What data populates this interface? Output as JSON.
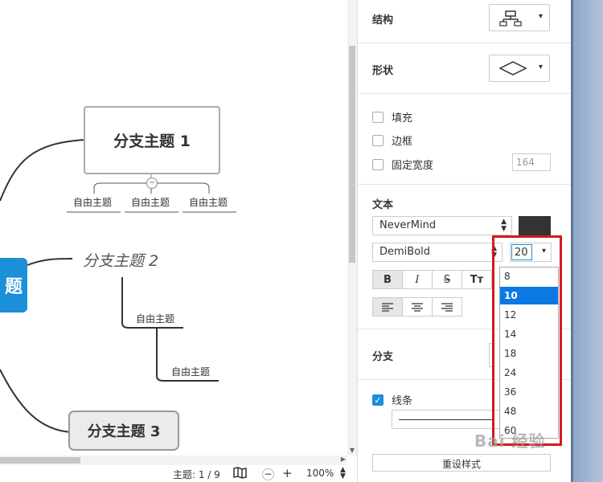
{
  "canvas": {
    "central_topic_fragment": "题",
    "branch1": "分支主题 1",
    "branch1_subtopics": [
      "自由主题",
      "自由主题",
      "自由主题"
    ],
    "branch2": "分支主题 2",
    "branch2_subtopics": [
      "自由主题",
      "自由主题"
    ],
    "branch3": "分支主题 3",
    "collapse_symbol": "−"
  },
  "statusbar": {
    "topic_count": "主题: 1 / 9",
    "zoom": "100%",
    "zoom_out": "−",
    "zoom_in": "+"
  },
  "panel": {
    "structure_label": "结构",
    "shape_label": "形状",
    "fill_label": "填充",
    "border_label": "边框",
    "fixed_width_label": "固定宽度",
    "fixed_width_value": "164",
    "text_label": "文本",
    "font_family": "NeverMind",
    "font_weight": "DemiBold",
    "font_size": "20",
    "text_color": "#333333",
    "format_buttons": [
      "B",
      "I",
      "S",
      "Tт"
    ],
    "branch_label": "分支",
    "line_label": "线条",
    "line_checked": true,
    "reset_label": "重设样式"
  },
  "font_size_dropdown": {
    "options": [
      "8",
      "10",
      "12",
      "14",
      "18",
      "24",
      "36",
      "48",
      "60"
    ],
    "selected": "10"
  },
  "watermark": "Bai 经验",
  "colors": {
    "accent": "#1b8fd8",
    "selection": "#0b78e3",
    "highlight": "#d61a1a"
  }
}
